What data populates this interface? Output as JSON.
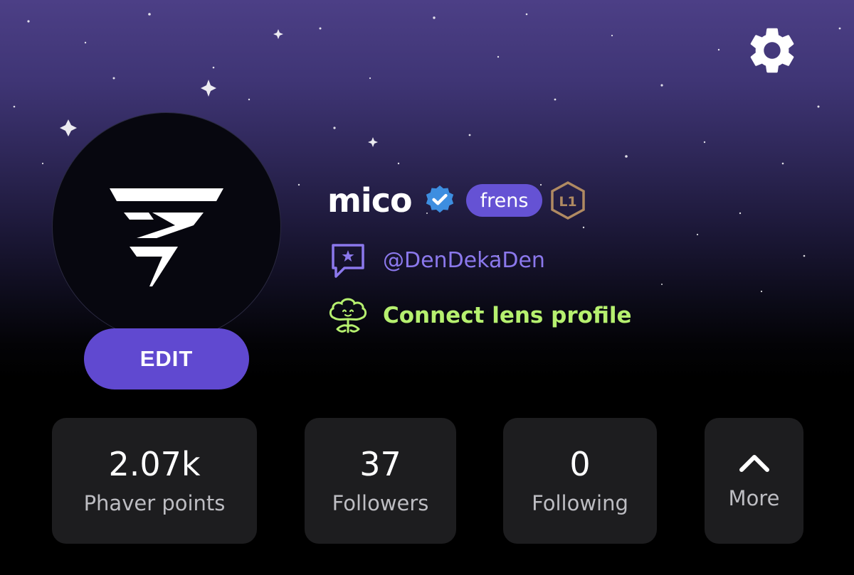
{
  "profile": {
    "name": "mico",
    "badge": "frens",
    "level": "L1",
    "handle": "@DenDekaDen",
    "lens_link": "Connect lens profile",
    "edit_label": "EDIT"
  },
  "icons": {
    "settings": "gear-icon",
    "verified": "verified-check-icon",
    "level": "hexagon-level-icon",
    "handle": "chat-star-icon",
    "lens": "lens-plant-icon",
    "more": "chevron-up-icon"
  },
  "stats": [
    {
      "value": "2.07k",
      "label": "Phaver points"
    },
    {
      "value": "37",
      "label": "Followers"
    },
    {
      "value": "0",
      "label": "Following"
    }
  ],
  "more": {
    "label": "More"
  },
  "colors": {
    "accent": "#6049d0",
    "handle": "#8b78ec",
    "lens": "#b6f06f",
    "verified": "#3d8ee0",
    "level": "#b08a62",
    "card": "#1d1d1f"
  }
}
